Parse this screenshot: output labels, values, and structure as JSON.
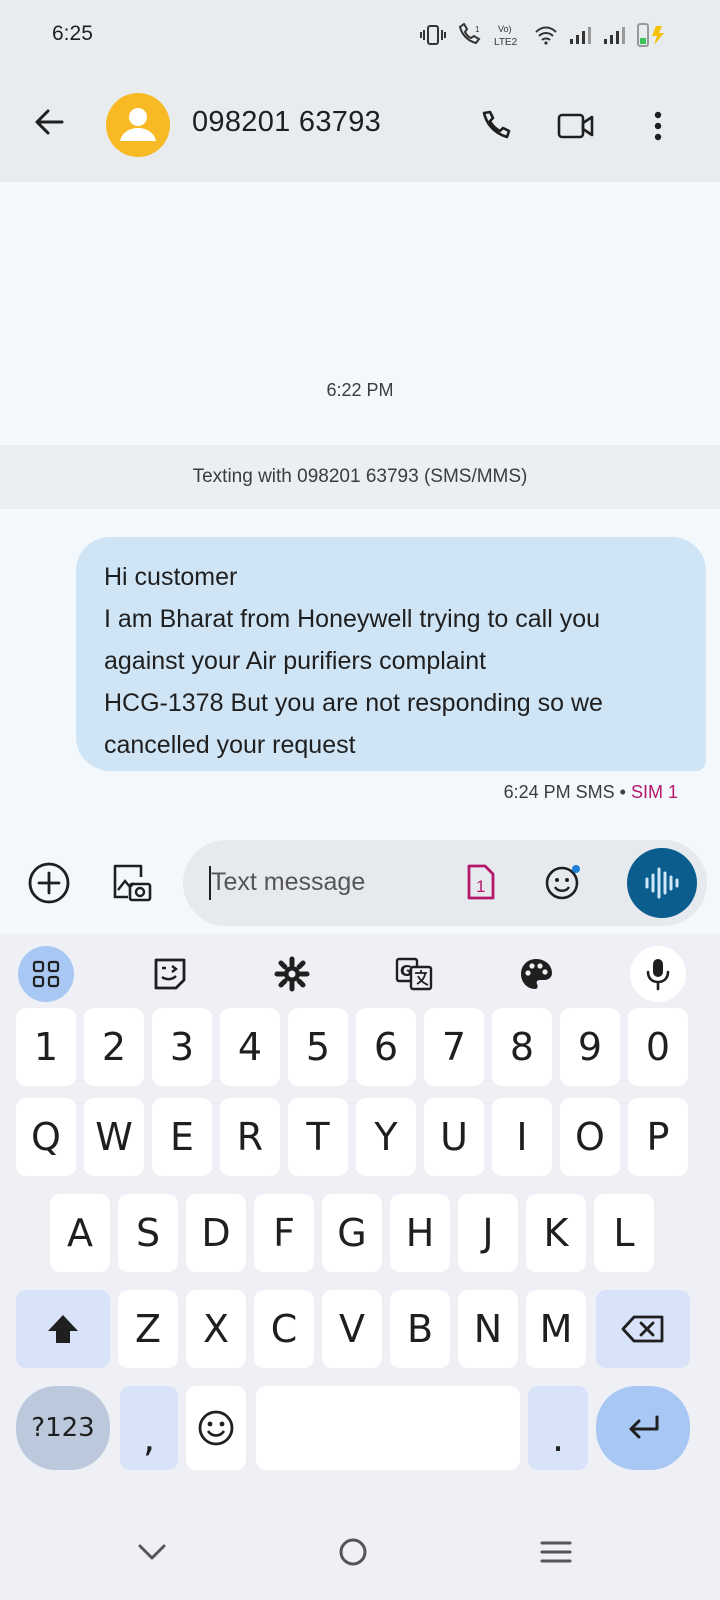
{
  "status": {
    "time": "6:25",
    "network_label": "LTE2",
    "volte_label": "Vo)"
  },
  "header": {
    "contact": "098201 63793",
    "avatar_color": "#f7b924"
  },
  "conversation": {
    "timestamp": "6:22 PM",
    "banner": "Texting with 098201 63793 (SMS/MMS)",
    "message_lines": [
      "Hi customer",
      "I am Bharat from Honeywell trying to call you",
      "against your Air purifiers complaint",
      "HCG-1378 But you are not responding so we",
      "cancelled your request"
    ],
    "meta_time": "6:24 PM",
    "meta_type": "SMS",
    "meta_sep": "•",
    "meta_sim": "SIM 1",
    "bubble_color": "#cfe4f5",
    "sim_color": "#b5176a"
  },
  "compose": {
    "placeholder": "Text message",
    "sim_badge": "1",
    "accent": "#0b5d8d"
  },
  "keyboard": {
    "row_numbers": [
      "1",
      "2",
      "3",
      "4",
      "5",
      "6",
      "7",
      "8",
      "9",
      "0"
    ],
    "row1": [
      "Q",
      "W",
      "E",
      "R",
      "T",
      "Y",
      "U",
      "I",
      "O",
      "P"
    ],
    "row2": [
      "A",
      "S",
      "D",
      "F",
      "G",
      "H",
      "J",
      "K",
      "L"
    ],
    "row3": [
      "Z",
      "X",
      "C",
      "V",
      "B",
      "N",
      "M"
    ],
    "symbols_label": "?123",
    "comma": ",",
    "period": "."
  }
}
